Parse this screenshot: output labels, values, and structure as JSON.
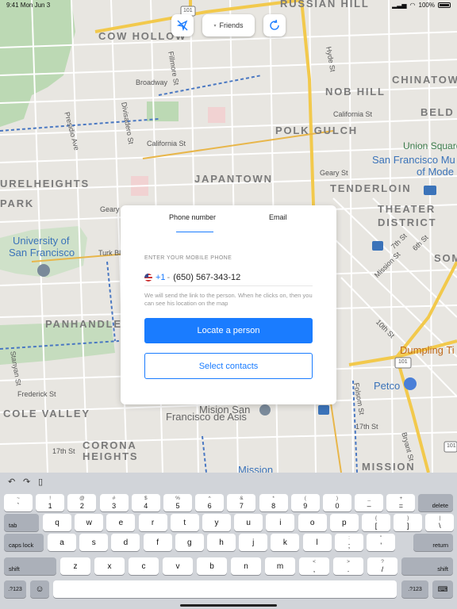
{
  "status_bar": {
    "time": "9:41 Mon Jun 3",
    "battery": "100%"
  },
  "map": {
    "districts": [
      "COW HOLLOW",
      "NOB HILL",
      "CHINATOW",
      "BELD",
      "POLK GULCH",
      "JAPANTOWN",
      "URELHEIGHTS",
      "PARK",
      "TENDERLOIN",
      "THEATER",
      "DISTRICT",
      "PANHANDLE",
      "SOM",
      "COLE VALLEY",
      "CORONA",
      "HEIGHTS",
      "MISSION",
      "RUSSIAN HILL"
    ],
    "streets": [
      "Broadway",
      "Fillmore St",
      "Divisadero St",
      "Presidio Ave",
      "California St",
      "California St",
      "Geary St",
      "Geary Blvd",
      "Turk Blvd",
      "Hyde St",
      "Stanyan St",
      "Frederick St",
      "17th St",
      "17th St",
      "Mission St",
      "6th St",
      "7th St",
      "10th St",
      "Folsom St",
      "Bryant St",
      "101",
      "101",
      "101"
    ],
    "pois": {
      "union_square": "Union Square",
      "sf_museum": "San Francisco Mu",
      "sf_museum_2": "of Mode",
      "usf_1": "University of",
      "usf_2": "San Francisco",
      "dumpling": "Dumpling Ti",
      "petco": "Petco",
      "mission_dolores_1": "Mision San",
      "mission_dolores_2": "Francisco de Asis",
      "mission_bottom": "Mission"
    }
  },
  "top_controls": {
    "friends_label": "Friends"
  },
  "card": {
    "tab_phone": "Phone number",
    "tab_email": "Email",
    "caption": "ENTER YOUR MOBILE PHONE",
    "country_code": "+1",
    "dash": "-",
    "phone": "(650) 567-343-12",
    "hint": "We will send the link to the person. When he clicks on, then you can see his location on the map",
    "locate_label": "Locate a person",
    "contacts_label": "Select contacts"
  },
  "keyboard": {
    "row1": [
      {
        "s": "~",
        "m": "`"
      },
      {
        "s": "!",
        "m": "1"
      },
      {
        "s": "@",
        "m": "2"
      },
      {
        "s": "#",
        "m": "3"
      },
      {
        "s": "$",
        "m": "4"
      },
      {
        "s": "%",
        "m": "5"
      },
      {
        "s": "^",
        "m": "6"
      },
      {
        "s": "&",
        "m": "7"
      },
      {
        "s": "*",
        "m": "8"
      },
      {
        "s": "(",
        "m": "9"
      },
      {
        "s": ")",
        "m": "0"
      },
      {
        "s": "_",
        "m": "–"
      },
      {
        "s": "+",
        "m": "="
      }
    ],
    "delete": "delete",
    "tab": "tab",
    "row2": [
      "q",
      "w",
      "e",
      "r",
      "t",
      "y",
      "u",
      "i",
      "o",
      "p"
    ],
    "row2_sym": [
      {
        "s": "{",
        "m": "["
      },
      {
        "s": "}",
        "m": "]"
      },
      {
        "s": "|",
        "m": "\\"
      }
    ],
    "caps": "caps lock",
    "row3": [
      "a",
      "s",
      "d",
      "f",
      "g",
      "h",
      "j",
      "k",
      "l"
    ],
    "row3_sym": [
      {
        "s": ":",
        "m": ";"
      },
      {
        "s": "\"",
        "m": "'"
      }
    ],
    "return": "return",
    "shift": "shift",
    "row4": [
      "z",
      "x",
      "c",
      "v",
      "b",
      "n",
      "m"
    ],
    "row4_sym": [
      {
        "s": "<",
        "m": ","
      },
      {
        "s": ">",
        "m": "."
      },
      {
        "s": "?",
        "m": "/"
      }
    ],
    "num_key": ".?123"
  }
}
